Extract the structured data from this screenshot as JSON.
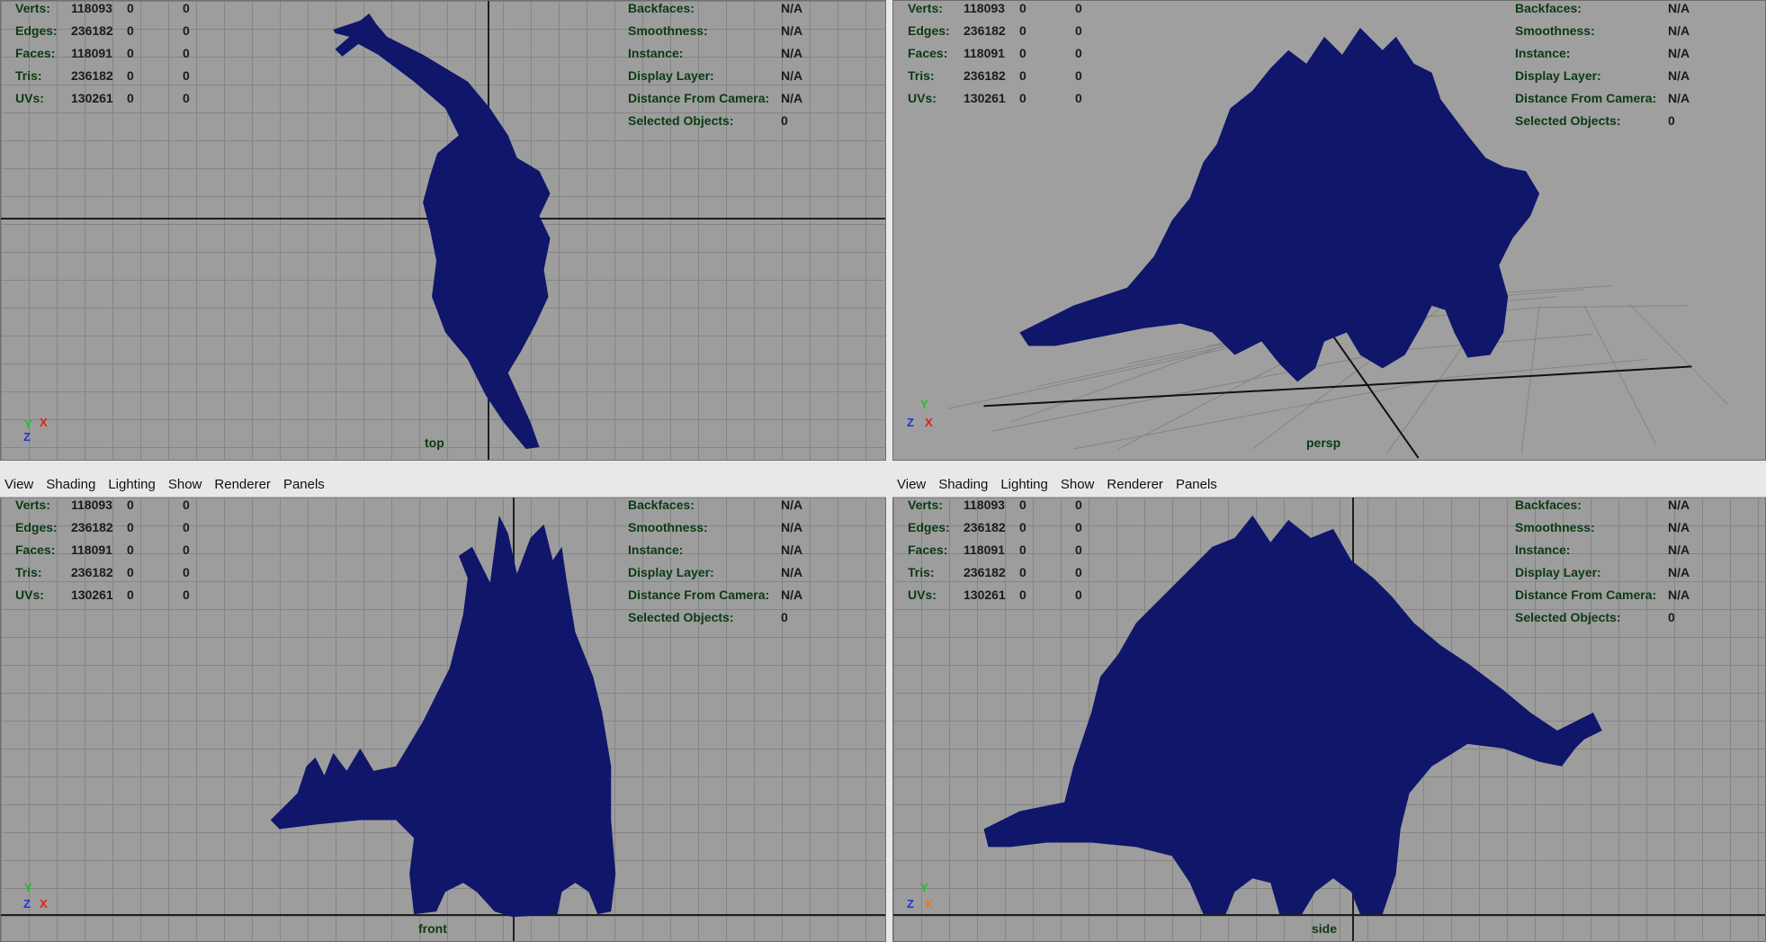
{
  "menu": [
    "View",
    "Shading",
    "Lighting",
    "Show",
    "Renderer",
    "Panels"
  ],
  "hud_left": [
    {
      "label": "Verts:",
      "values": [
        "118093",
        "0",
        "0"
      ]
    },
    {
      "label": "Edges:",
      "values": [
        "236182",
        "0",
        "0"
      ]
    },
    {
      "label": "Faces:",
      "values": [
        "118091",
        "0",
        "0"
      ]
    },
    {
      "label": "Tris:",
      "values": [
        "236182",
        "0",
        "0"
      ]
    },
    {
      "label": "UVs:",
      "values": [
        "130261",
        "0",
        "0"
      ]
    }
  ],
  "hud_right": [
    {
      "label": "Backfaces:",
      "value": "N/A"
    },
    {
      "label": "Smoothness:",
      "value": "N/A"
    },
    {
      "label": "Instance:",
      "value": "N/A"
    },
    {
      "label": "Display Layer:",
      "value": "N/A"
    },
    {
      "label": "Distance From Camera:",
      "value": "N/A"
    },
    {
      "label": "Selected Objects:",
      "value": "0"
    }
  ],
  "viewports": {
    "top": {
      "camera": "top"
    },
    "persp": {
      "camera": "persp"
    },
    "front": {
      "camera": "front"
    },
    "side": {
      "camera": "side"
    }
  },
  "gizmo": {
    "x": "X",
    "y": "Y",
    "z": "Z"
  },
  "colors": {
    "mesh": "#10166a",
    "hud_text": "#0b3a12",
    "viewport_bg": "#9d9d9d",
    "x_axis": "#e0201b",
    "y_axis": "#1fc21f",
    "z_axis": "#2233cc"
  }
}
